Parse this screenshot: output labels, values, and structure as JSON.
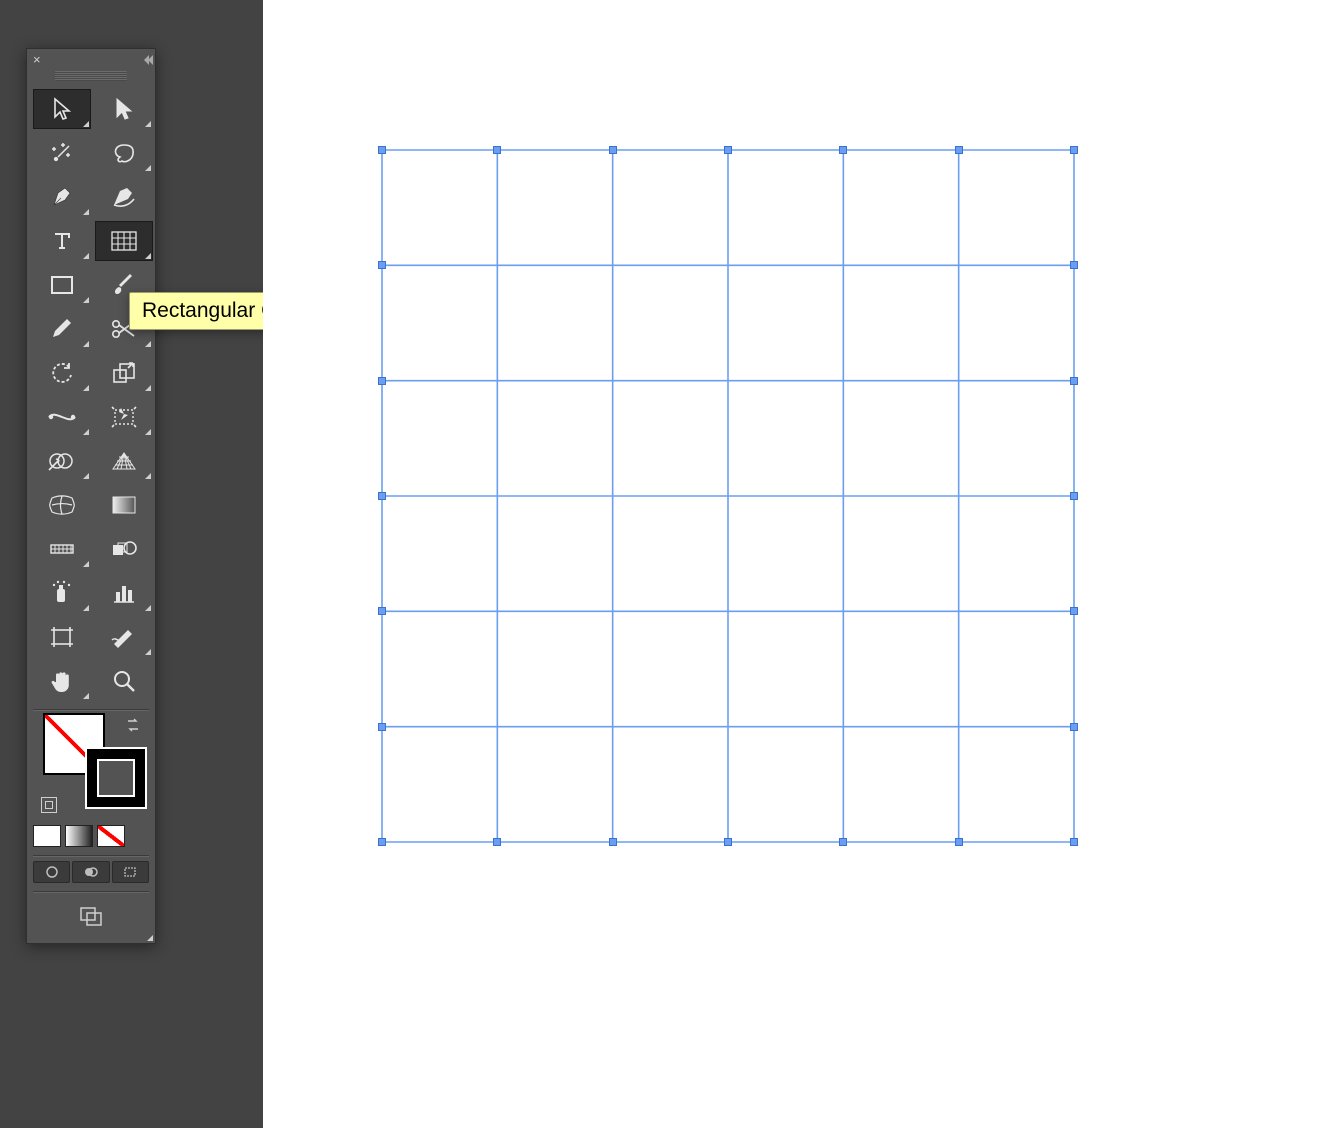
{
  "tooltip": {
    "text": "Rectangular Grid Tool"
  },
  "tools": {
    "selection": {
      "label": "Selection Tool"
    },
    "direct_select": {
      "label": "Direct Selection Tool"
    },
    "magic_wand": {
      "label": "Magic Wand Tool"
    },
    "lasso": {
      "label": "Lasso Tool"
    },
    "pen": {
      "label": "Pen Tool"
    },
    "curvature": {
      "label": "Curvature Tool"
    },
    "type": {
      "label": "Type Tool"
    },
    "rect_grid": {
      "label": "Rectangular Grid Tool",
      "selected": true
    },
    "rectangle": {
      "label": "Rectangle Tool"
    },
    "paintbrush": {
      "label": "Paintbrush Tool"
    },
    "pencil": {
      "label": "Pencil Tool"
    },
    "scissors": {
      "label": "Scissors Tool"
    },
    "rotate": {
      "label": "Rotate Tool"
    },
    "scale": {
      "label": "Scale Tool"
    },
    "width": {
      "label": "Width Tool"
    },
    "free_transform": {
      "label": "Free Transform Tool"
    },
    "shape_builder": {
      "label": "Shape Builder Tool"
    },
    "perspective": {
      "label": "Perspective Grid Tool"
    },
    "mesh": {
      "label": "Mesh Tool"
    },
    "gradient": {
      "label": "Gradient Tool"
    },
    "eyedropper": {
      "label": "Eyedropper Tool"
    },
    "blend": {
      "label": "Blend Tool"
    },
    "symbol_spray": {
      "label": "Symbol Sprayer Tool"
    },
    "graph": {
      "label": "Column Graph Tool"
    },
    "artboard": {
      "label": "Artboard Tool"
    },
    "slice": {
      "label": "Slice Tool"
    },
    "hand": {
      "label": "Hand Tool"
    },
    "zoom": {
      "label": "Zoom Tool"
    }
  },
  "swatches": {
    "fill": "none",
    "stroke": "#000000",
    "modes": [
      "color",
      "gradient",
      "none"
    ]
  },
  "draw_modes": [
    "normal",
    "behind",
    "inside"
  ],
  "canvas": {
    "grid_rows": 6,
    "grid_cols": 6,
    "stroke_color": "#6a9ef2",
    "selected": true
  }
}
